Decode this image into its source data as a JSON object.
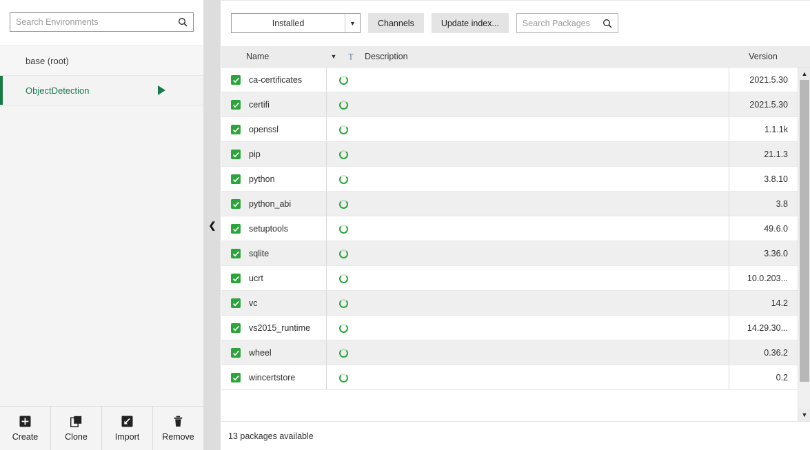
{
  "environments": {
    "search": {
      "placeholder": "Search Environments",
      "value": "",
      "icon": "search-icon"
    },
    "items": [
      {
        "name": "base (root)",
        "selected": false,
        "running": false
      },
      {
        "name": "ObjectDetection",
        "selected": true,
        "running": true
      }
    ],
    "toolbar": [
      {
        "label": "Create",
        "icon": "plus-square-icon"
      },
      {
        "label": "Clone",
        "icon": "copy-icon"
      },
      {
        "label": "Import",
        "icon": "import-arrow-icon"
      },
      {
        "label": "Remove",
        "icon": "trash-icon"
      }
    ]
  },
  "divider": {
    "icon": "chevron-left-icon"
  },
  "packages": {
    "filter": {
      "selected": "Installed",
      "icon": "chevron-down-icon"
    },
    "channels_label": "Channels",
    "update_index_label": "Update index...",
    "search": {
      "placeholder": "Search Packages",
      "value": "",
      "icon": "search-icon"
    },
    "columns": {
      "name": "Name",
      "sort_icon": "chevron-down-icon",
      "type": "T",
      "description": "Description",
      "version": "Version"
    },
    "rows": [
      {
        "checked": true,
        "name": "ca-certificates",
        "status": "installed-ring-icon",
        "description": "",
        "version": "2021.5.30"
      },
      {
        "checked": true,
        "name": "certifi",
        "status": "installed-ring-icon",
        "description": "",
        "version": "2021.5.30"
      },
      {
        "checked": true,
        "name": "openssl",
        "status": "installed-ring-icon",
        "description": "",
        "version": "1.1.1k"
      },
      {
        "checked": true,
        "name": "pip",
        "status": "installed-ring-icon",
        "description": "",
        "version": "21.1.3"
      },
      {
        "checked": true,
        "name": "python",
        "status": "installed-ring-icon",
        "description": "",
        "version": "3.8.10"
      },
      {
        "checked": true,
        "name": "python_abi",
        "status": "installed-ring-icon",
        "description": "",
        "version": "3.8"
      },
      {
        "checked": true,
        "name": "setuptools",
        "status": "installed-ring-icon",
        "description": "",
        "version": "49.6.0"
      },
      {
        "checked": true,
        "name": "sqlite",
        "status": "installed-ring-icon",
        "description": "",
        "version": "3.36.0"
      },
      {
        "checked": true,
        "name": "ucrt",
        "status": "installed-ring-icon",
        "description": "",
        "version": "10.0.203..."
      },
      {
        "checked": true,
        "name": "vc",
        "status": "installed-ring-icon",
        "description": "",
        "version": "14.2"
      },
      {
        "checked": true,
        "name": "vs2015_runtime",
        "status": "installed-ring-icon",
        "description": "",
        "version": "14.29.30..."
      },
      {
        "checked": true,
        "name": "wheel",
        "status": "installed-ring-icon",
        "description": "",
        "version": "0.36.2"
      },
      {
        "checked": true,
        "name": "wincertstore",
        "status": "installed-ring-icon",
        "description": "",
        "version": "0.2"
      }
    ],
    "scrollbar": {
      "up_icon": "chevron-up-icon",
      "down_icon": "chevron-down-icon"
    }
  },
  "statusbar": {
    "text": "13 packages available"
  },
  "colors": {
    "accent_green": "#1a7a47",
    "checkbox_green": "#2aa53a",
    "panel_bg": "#f4f4f4",
    "header_bg": "#ececec",
    "divider_bg": "#dddddd",
    "row_alt": "#efefef"
  }
}
